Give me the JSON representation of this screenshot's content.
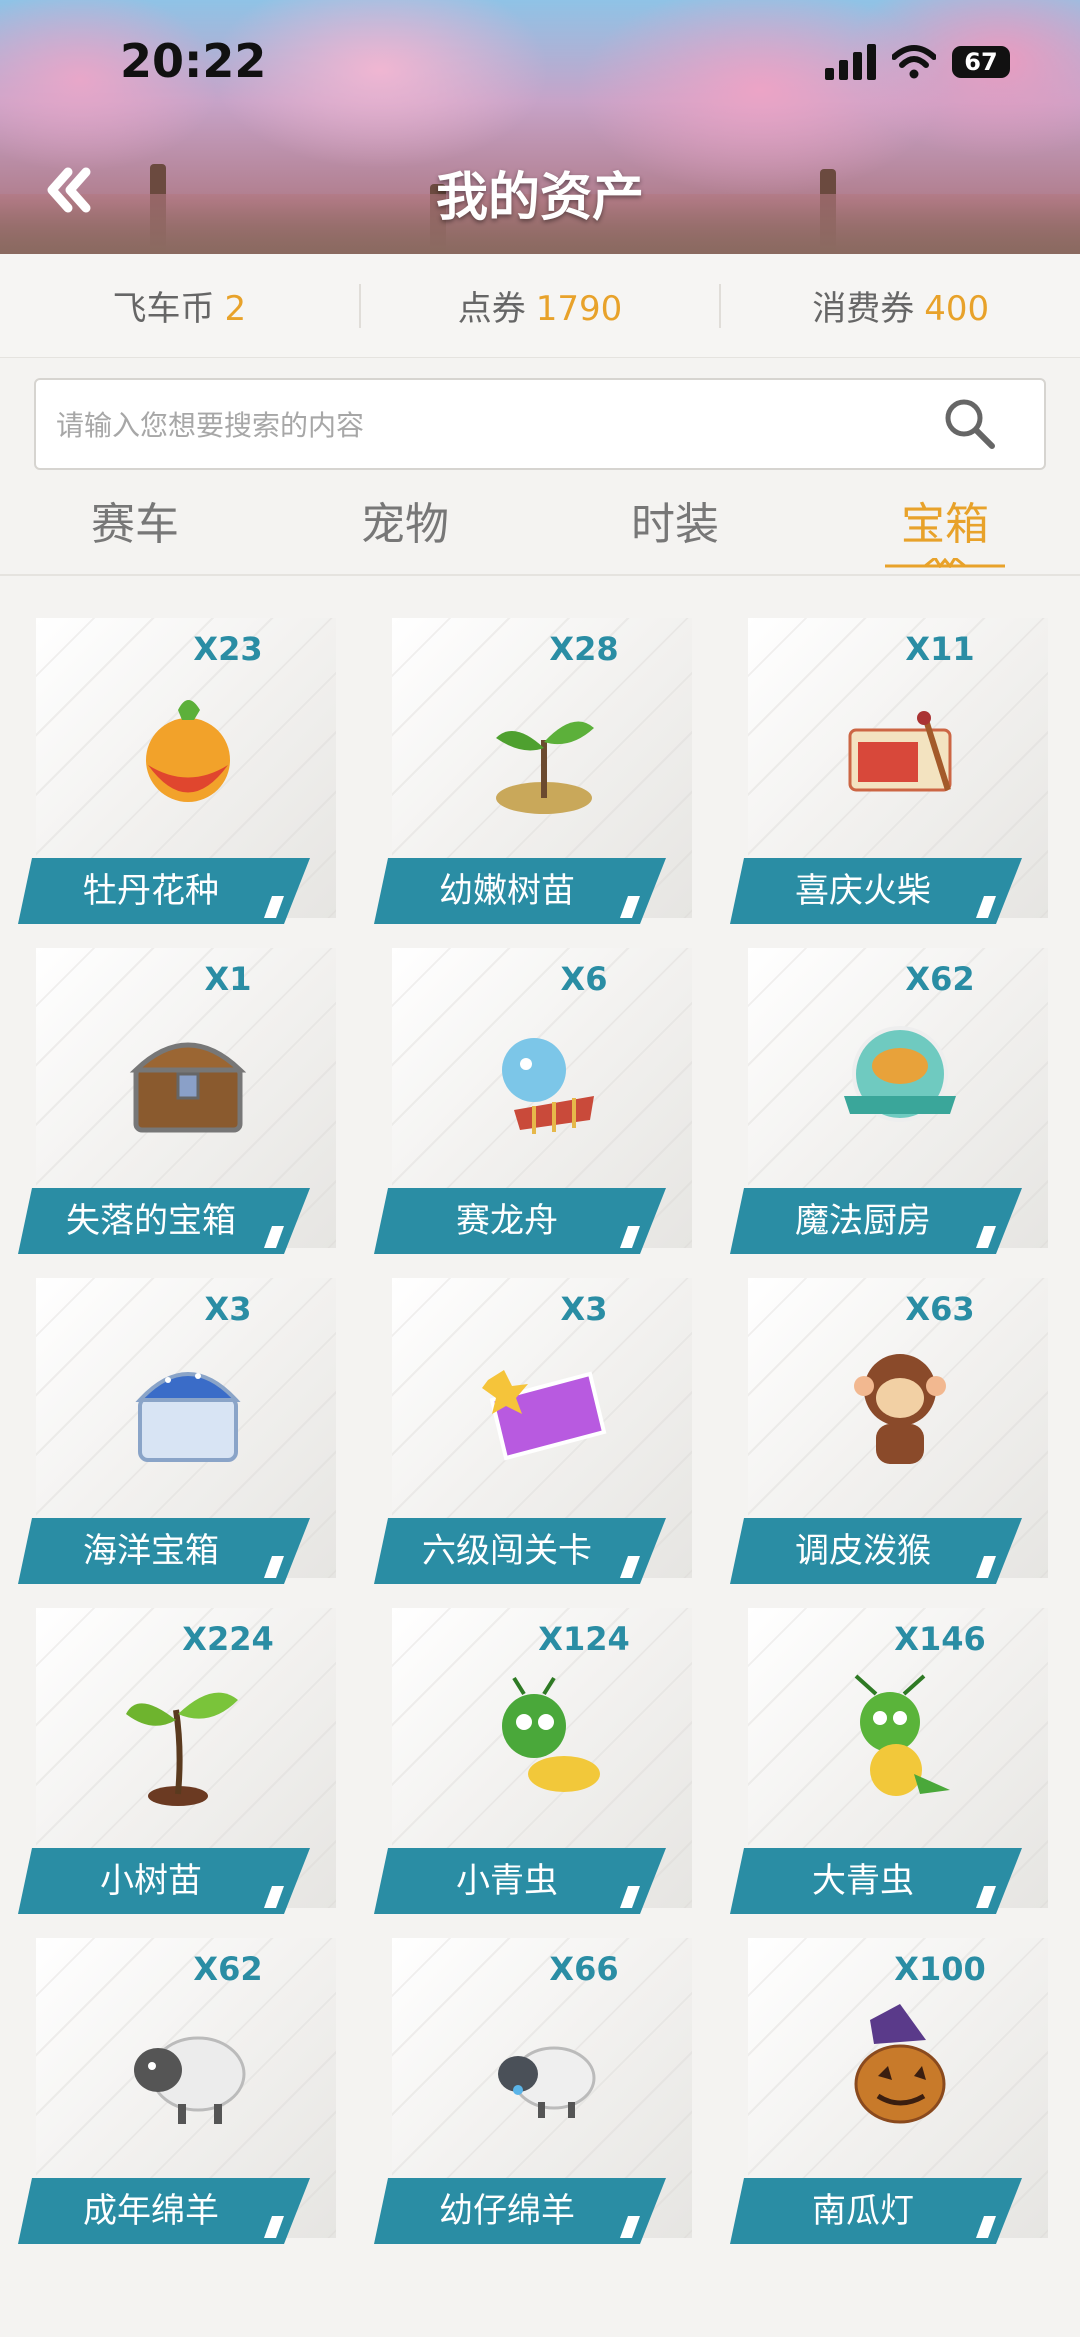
{
  "status": {
    "time": "20:22",
    "battery": "67"
  },
  "header": {
    "title": "我的资产"
  },
  "currency": [
    {
      "label": "飞车币",
      "value": "2"
    },
    {
      "label": "点券",
      "value": "1790"
    },
    {
      "label": "消费券",
      "value": "400"
    }
  ],
  "search": {
    "placeholder": "请输入您想要搜索的内容"
  },
  "tabs": [
    {
      "label": "赛车"
    },
    {
      "label": "宠物"
    },
    {
      "label": "时装"
    },
    {
      "label": "宝箱",
      "active": true
    }
  ],
  "items": [
    {
      "name": "牡丹花种",
      "count": "X23",
      "icon": "peony-seed-icon"
    },
    {
      "name": "幼嫩树苗",
      "count": "X28",
      "icon": "seedling-icon"
    },
    {
      "name": "喜庆火柴",
      "count": "X11",
      "icon": "matchbox-icon"
    },
    {
      "name": "失落的宝箱",
      "count": "X1",
      "icon": "treasure-chest-icon"
    },
    {
      "name": "赛龙舟",
      "count": "X6",
      "icon": "dragon-boat-icon"
    },
    {
      "name": "魔法厨房",
      "count": "X62",
      "icon": "magic-kitchen-icon"
    },
    {
      "name": "海洋宝箱",
      "count": "X3",
      "icon": "ocean-chest-icon"
    },
    {
      "name": "六级闯关卡",
      "count": "X3",
      "icon": "level-card-icon"
    },
    {
      "name": "调皮泼猴",
      "count": "X63",
      "icon": "monkey-icon"
    },
    {
      "name": "小树苗",
      "count": "X224",
      "icon": "sapling-icon"
    },
    {
      "name": "小青虫",
      "count": "X124",
      "icon": "small-caterpillar-icon"
    },
    {
      "name": "大青虫",
      "count": "X146",
      "icon": "big-caterpillar-icon"
    },
    {
      "name": "成年绵羊",
      "count": "X62",
      "icon": "adult-sheep-icon"
    },
    {
      "name": "幼仔绵羊",
      "count": "X66",
      "icon": "lamb-icon"
    },
    {
      "name": "南瓜灯",
      "count": "X100",
      "icon": "pumpkin-lantern-icon"
    }
  ],
  "colors": {
    "accent": "#e8a22a",
    "teal": "#2a8da4"
  }
}
